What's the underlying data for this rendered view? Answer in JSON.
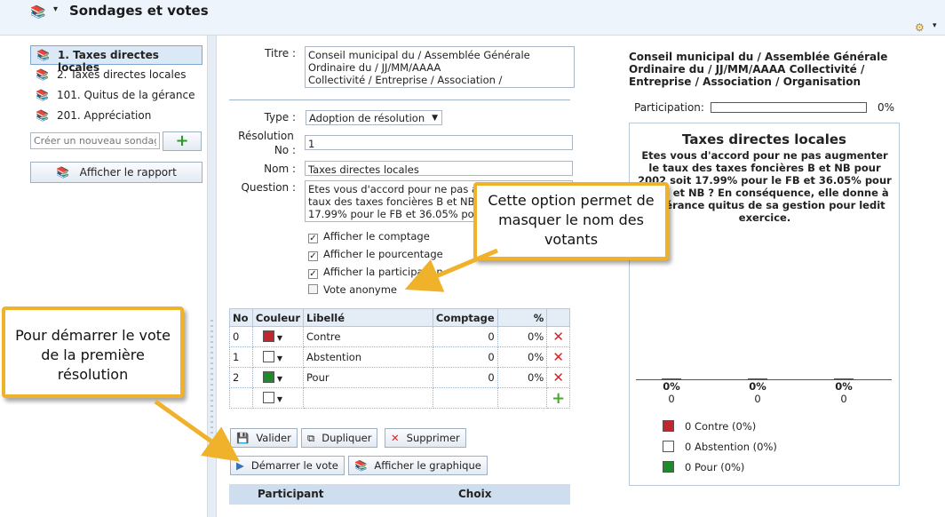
{
  "app": {
    "title": "Sondages et votes"
  },
  "sidebar": {
    "items": [
      {
        "label": "1. Taxes directes locales"
      },
      {
        "label": "2. Taxes directes locales"
      },
      {
        "label": "101. Quitus de la gérance"
      },
      {
        "label": "201. Appréciation"
      }
    ],
    "create_placeholder": "Créer un nouveau sondage",
    "report_label": "Afficher le rapport"
  },
  "form": {
    "titre_label": "Titre :",
    "titre_value": "Conseil municipal du / Assemblée Générale\nOrdinaire du / JJ/MM/AAAA\nCollectivité  / Entreprise / Association /",
    "type_label": "Type :",
    "type_value": "Adoption de résolution",
    "resolution_label_1": "Résolution",
    "resolution_label_2": "No :",
    "resolution_value": "1",
    "nom_label": "Nom :",
    "nom_value": "Taxes directes locales",
    "question_label": "Question :",
    "question_value": "Etes vous d'accord pour ne pas a\ntaux des taxes foncières B et NB\n17.99% pour le FB et 36.05% pour",
    "options": [
      {
        "label": "Afficher le comptage",
        "checked": true
      },
      {
        "label": "Afficher le pourcentage",
        "checked": true
      },
      {
        "label": "Afficher la participation",
        "checked": true
      },
      {
        "label": "Vote anonyme",
        "checked": false
      }
    ]
  },
  "table": {
    "headers": {
      "no": "No",
      "couleur": "Couleur",
      "libelle": "Libellé",
      "comptage": "Comptage",
      "pct": "%"
    },
    "rows": [
      {
        "no": "0",
        "color": "#c0282d",
        "libelle": "Contre",
        "comptage": "0",
        "pct": "0%"
      },
      {
        "no": "1",
        "color": "#ffffff",
        "libelle": "Abstention",
        "comptage": "0",
        "pct": "0%"
      },
      {
        "no": "2",
        "color": "#1e8a2a",
        "libelle": "Pour",
        "comptage": "0",
        "pct": "0%"
      }
    ],
    "new_row_color": "#ffffff"
  },
  "actions": {
    "valider": "Valider",
    "dupliquer": "Dupliquer",
    "supprimer": "Supprimer",
    "demarrer": "Démarrer le vote",
    "graphique": "Afficher le graphique"
  },
  "participants": {
    "col_participant": "Participant",
    "col_choix": "Choix"
  },
  "preview": {
    "title": "Conseil municipal du / Assemblée Générale\nOrdinaire du / JJ/MM/AAAA Collectivité /\nEntreprise / Association / Organisation",
    "participation_label": "Participation:",
    "participation_value": "0%",
    "participation_fraction": 0
  },
  "chart_data": {
    "type": "bar",
    "title": "Taxes directes locales",
    "subtitle": "Etes vous d'accord pour ne pas augmenter le taux des taxes foncières B et NB pour 2002 soit 17.99% pour le FB et 36.05% pour le FB et NB ? En conséquence, elle donne à la gérance quitus de sa gestion pour ledit exercice.",
    "categories": [
      "Contre",
      "Abstention",
      "Pour"
    ],
    "values": [
      0,
      0,
      0
    ],
    "percent_labels": [
      "0%",
      "0%",
      "0%"
    ],
    "count_labels": [
      "0",
      "0",
      "0"
    ],
    "colors": [
      "#c0282d",
      "#ffffff",
      "#1e8a2a"
    ],
    "legend": [
      "0 Contre (0%)",
      "0 Abstention (0%)",
      "0 Pour (0%)"
    ],
    "legend_position": "bottom"
  },
  "callouts": {
    "option": "Cette option permet de\nmasquer le nom des\nvotants",
    "demarrer": "Pour démarrer le vote\nde la première\nrésolution"
  }
}
